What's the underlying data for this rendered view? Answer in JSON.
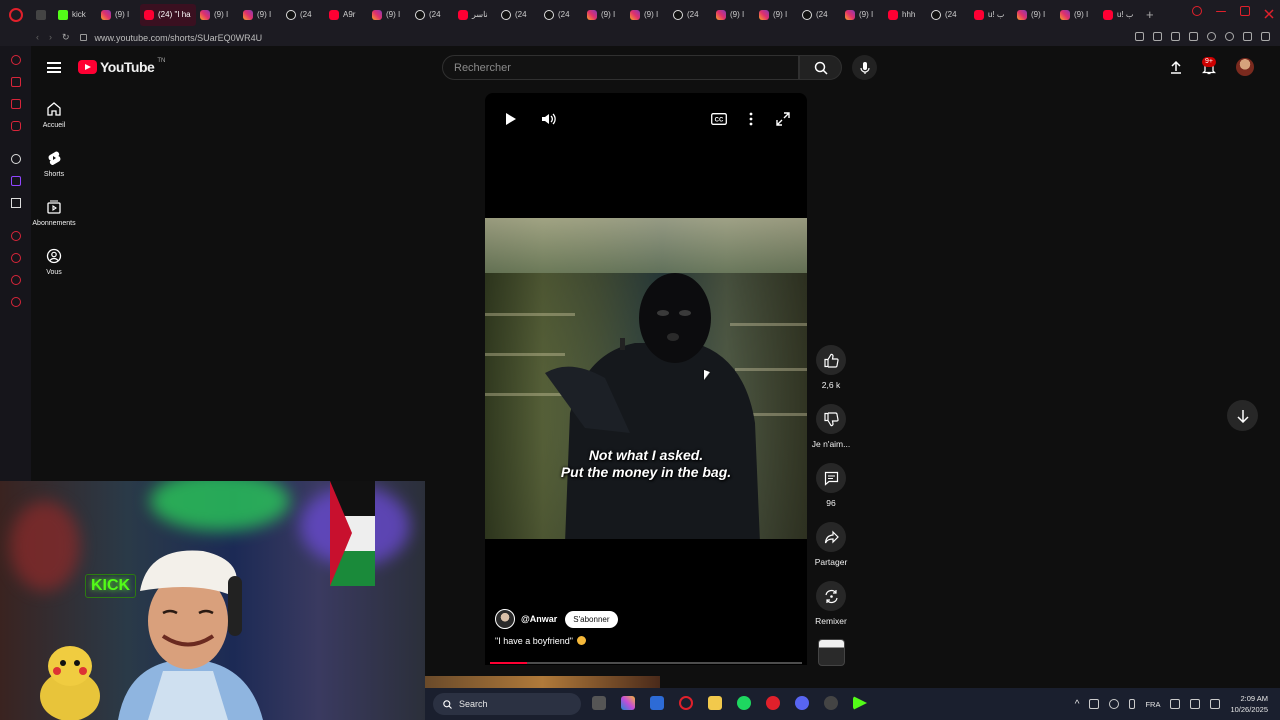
{
  "browser": {
    "tabs": [
      {
        "label": "",
        "favicon": "tab-switcher-icon"
      },
      {
        "label": "kick",
        "favicon": "kick-icon"
      },
      {
        "label": "(9) I",
        "favicon": "instagram-icon"
      },
      {
        "label": "(24) \"I ha",
        "favicon": "youtube-icon",
        "active": true
      },
      {
        "label": "(9) I",
        "favicon": "instagram-icon"
      },
      {
        "label": "(9) I",
        "favicon": "instagram-icon"
      },
      {
        "label": "(24",
        "favicon": "tiktok-icon"
      },
      {
        "label": "A9r",
        "favicon": "youtube-icon"
      },
      {
        "label": "(9) I",
        "favicon": "instagram-icon"
      },
      {
        "label": "(24",
        "favicon": "tiktok-icon"
      },
      {
        "label": "ناسر",
        "favicon": "youtube-icon"
      },
      {
        "label": "(24",
        "favicon": "tiktok-icon"
      },
      {
        "label": "(24",
        "favicon": "tiktok-icon"
      },
      {
        "label": "(9) I",
        "favicon": "instagram-icon"
      },
      {
        "label": "(9) I",
        "favicon": "instagram-icon"
      },
      {
        "label": "(24",
        "favicon": "tiktok-icon"
      },
      {
        "label": "(9) I",
        "favicon": "instagram-icon"
      },
      {
        "label": "(9) I",
        "favicon": "instagram-icon"
      },
      {
        "label": "(24",
        "favicon": "tiktok-icon"
      },
      {
        "label": "(9) I",
        "favicon": "instagram-icon"
      },
      {
        "label": "hhh",
        "favicon": "youtube-icon"
      },
      {
        "label": "(24",
        "favicon": "tiktok-icon"
      },
      {
        "label": "u! ب",
        "favicon": "youtube-icon"
      },
      {
        "label": "(9) I",
        "favicon": "instagram-icon"
      },
      {
        "label": "(9) I",
        "favicon": "instagram-icon"
      },
      {
        "label": "u! ب",
        "favicon": "youtube-icon"
      }
    ],
    "url": "www.youtube.com/shorts/SUarEQ0WR4U",
    "accent_color": "#e0202b"
  },
  "youtube": {
    "logo_text": "YouTube",
    "region_code": "TN",
    "search_placeholder": "Rechercher",
    "notification_count": "9+",
    "nav": [
      {
        "label": "Accueil",
        "icon": "home-icon"
      },
      {
        "label": "Shorts",
        "icon": "shorts-icon"
      },
      {
        "label": "Abonnements",
        "icon": "subscriptions-icon"
      },
      {
        "label": "Vous",
        "icon": "account-icon"
      }
    ]
  },
  "short": {
    "subtitle_line1": "Not what I asked.",
    "subtitle_line2": "Put the money in the bag.",
    "channel": "@Anwar",
    "subscribe_label": "S'abonner",
    "caption": "\"I have a boyfriend\"",
    "progress": 0.12,
    "likes": "2,6 k",
    "dislike_label": "Je n'aim...",
    "comments": "96",
    "share_label": "Partager",
    "remix_label": "Remixer"
  },
  "webcam": {
    "sign_text": "KICK"
  },
  "taskbar": {
    "search_label": "Search",
    "language": "FRA",
    "time": "2:09 AM",
    "date": "10/26/2025"
  }
}
